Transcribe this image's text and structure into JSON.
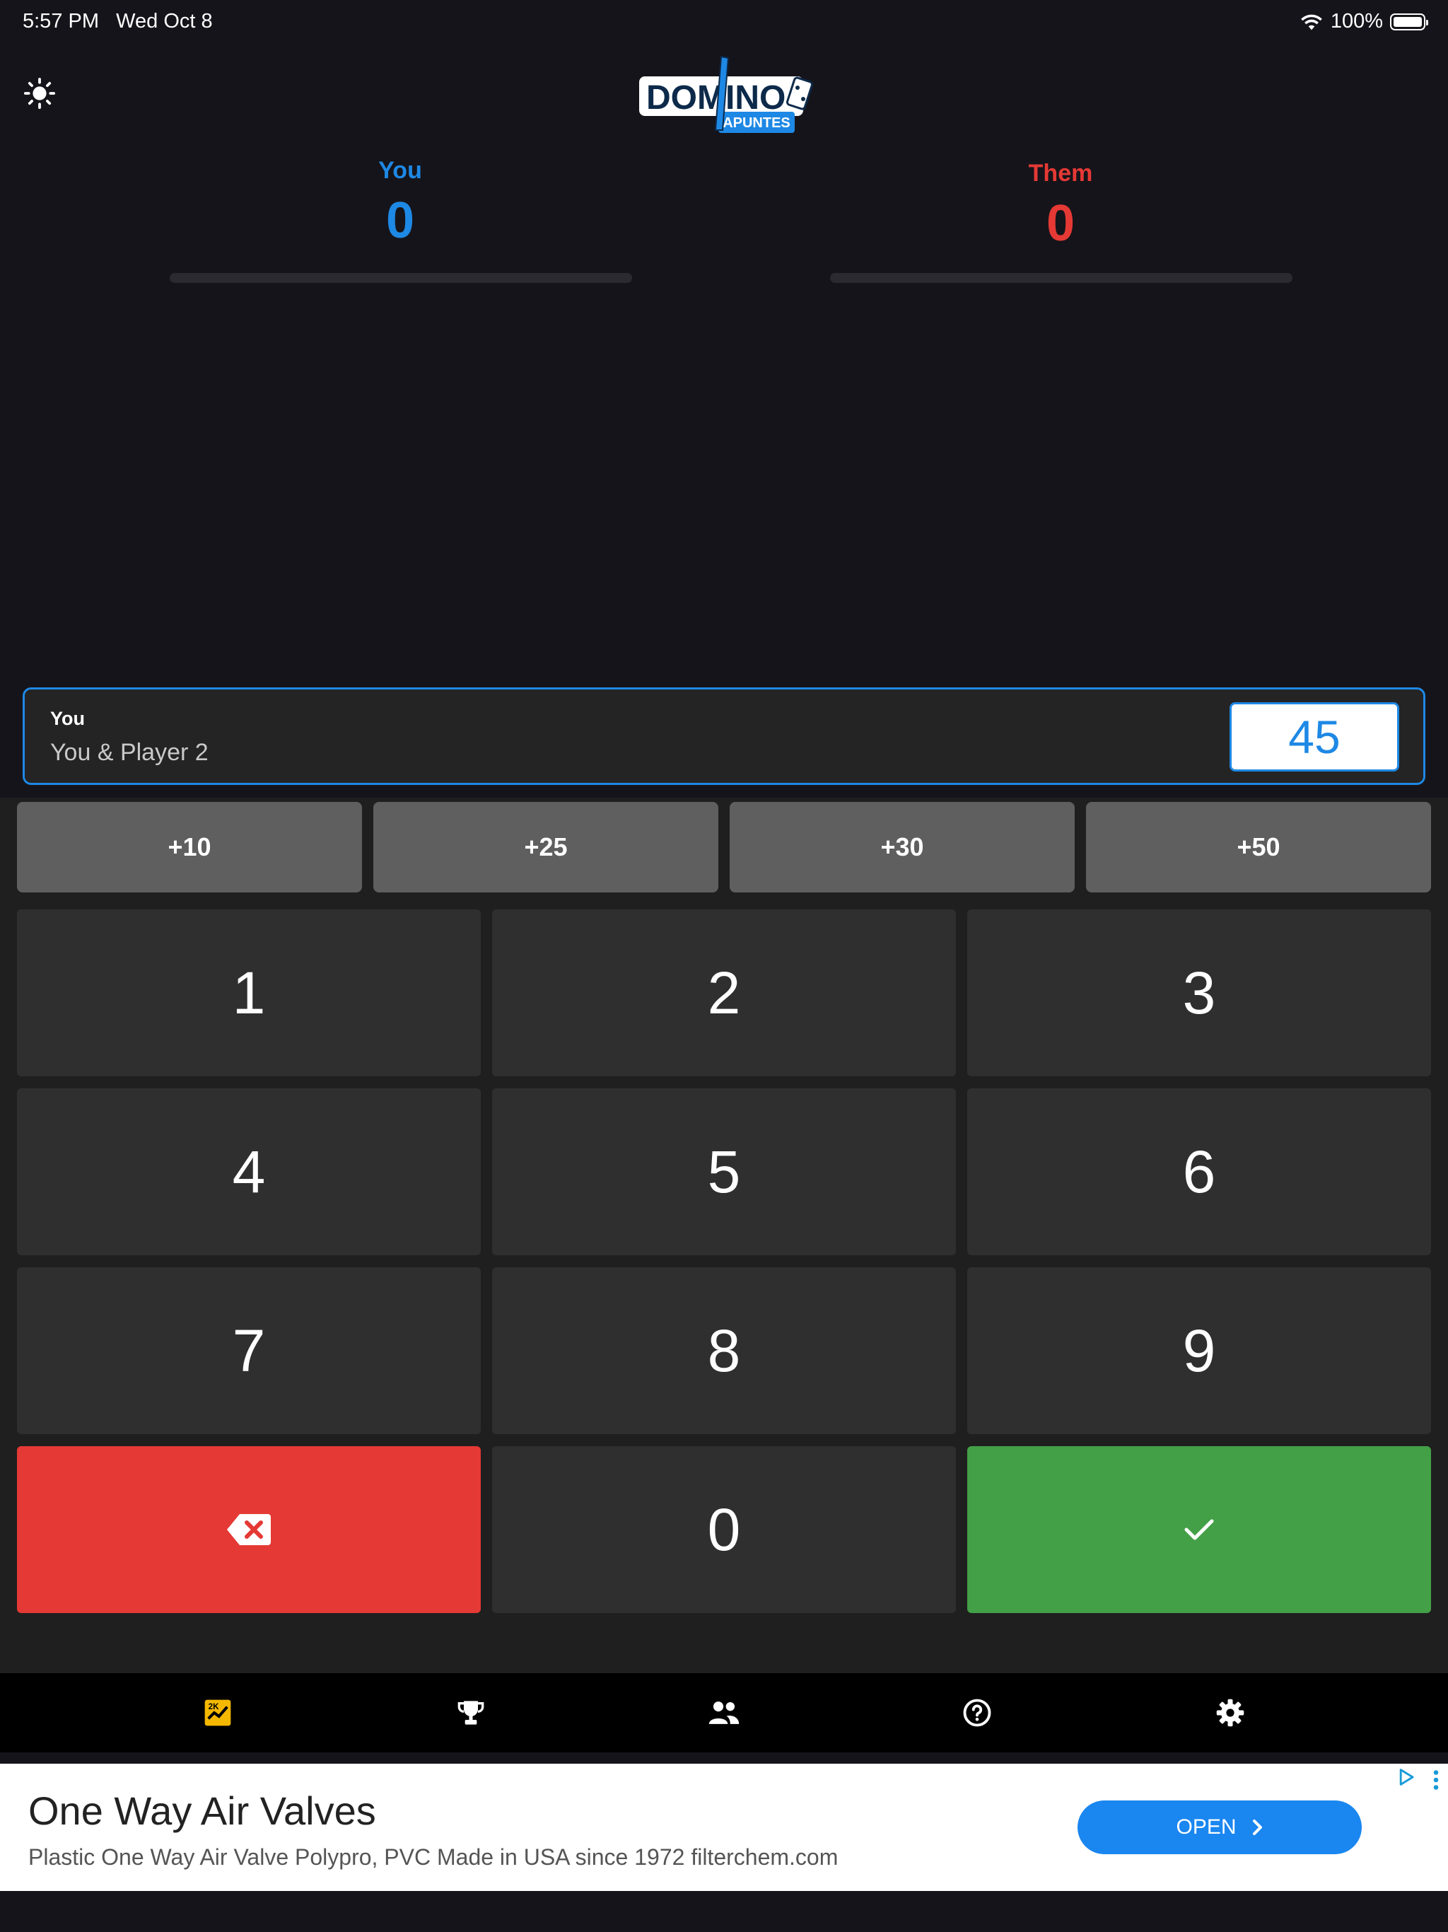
{
  "status_bar": {
    "time": "5:57 PM",
    "date": "Wed Oct 8",
    "battery": "100%"
  },
  "app": {
    "logo_text": "DOMINO",
    "logo_subtext": "APUNTES"
  },
  "teams": [
    {
      "name": "You",
      "score": "0",
      "color": "#1e88e5"
    },
    {
      "name": "Them",
      "score": "0",
      "color": "#e53935"
    }
  ],
  "entry": {
    "team": "You",
    "players": "You & Player 2",
    "value": "45"
  },
  "quick_add": [
    "+10",
    "+25",
    "+30",
    "+50"
  ],
  "keypad": {
    "digits": [
      "1",
      "2",
      "3",
      "4",
      "5",
      "6",
      "7",
      "8",
      "9",
      "0"
    ]
  },
  "bottom_nav": [
    {
      "icon": "scoreboard-icon",
      "active": true
    },
    {
      "icon": "trophy-icon",
      "active": false
    },
    {
      "icon": "people-icon",
      "active": false
    },
    {
      "icon": "help-icon",
      "active": false
    },
    {
      "icon": "settings-icon",
      "active": false
    }
  ],
  "ad": {
    "title": "One Way Air Valves",
    "description": "Plastic One Way Air Valve Polypro, PVC Made in USA since 1972 filterchem.com",
    "cta": "OPEN"
  },
  "colors": {
    "accent": "#1e88e5",
    "danger": "#e53935",
    "success": "#43a047",
    "active_nav": "#f5b800"
  }
}
